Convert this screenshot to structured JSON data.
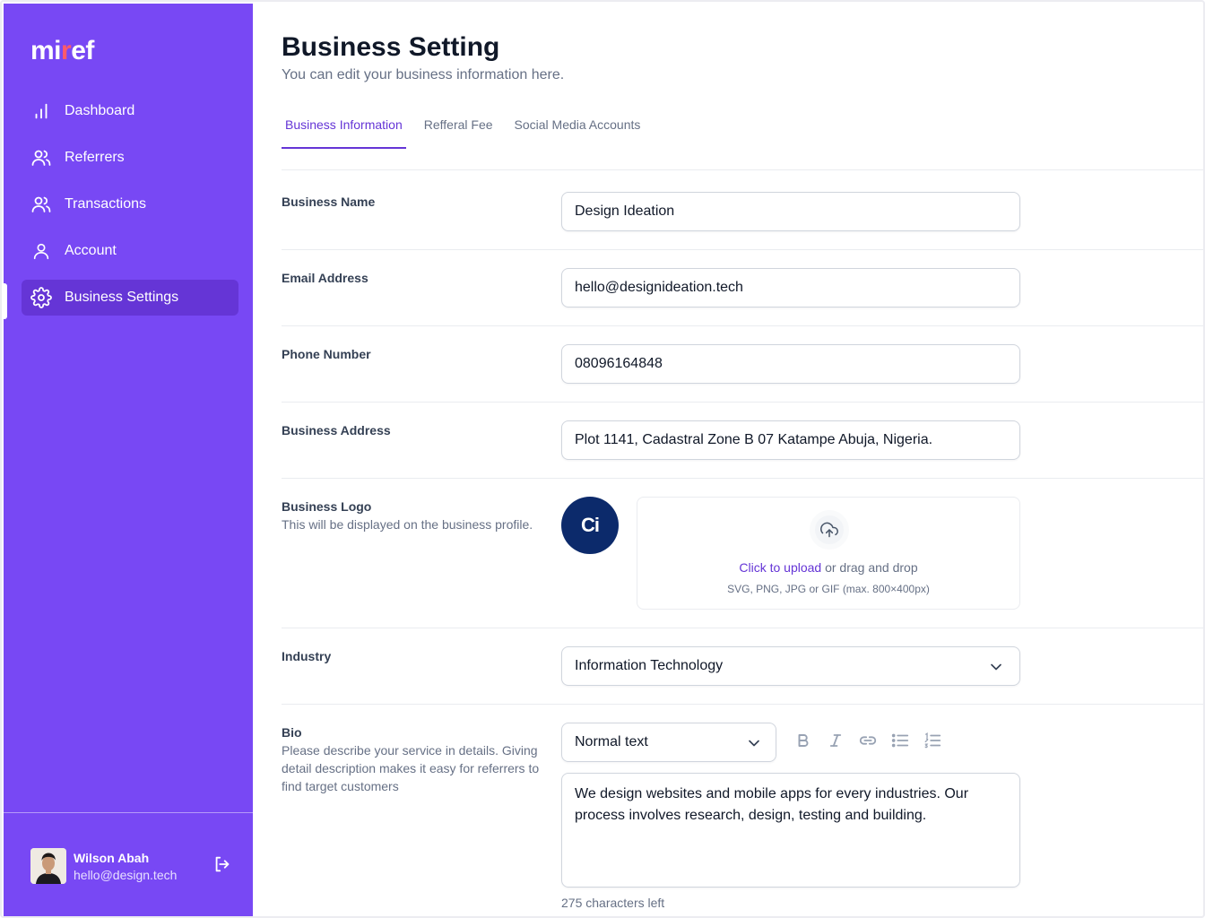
{
  "brand": {
    "logo_pre": "mi",
    "logo_r": "r",
    "logo_post": "ef",
    "accent": "#7848f4",
    "accent_dark": "#6535d6",
    "logo_r_color": "#ff5a6a"
  },
  "sidebar": {
    "items": [
      {
        "label": "Dashboard",
        "icon": "bar-chart-icon"
      },
      {
        "label": "Referrers",
        "icon": "users-icon"
      },
      {
        "label": "Transactions",
        "icon": "users-icon"
      },
      {
        "label": "Account",
        "icon": "user-icon"
      },
      {
        "label": "Business Settings",
        "icon": "gear-icon",
        "active": true
      }
    ],
    "user": {
      "name": "Wilson Abah",
      "email": "hello@design.tech"
    }
  },
  "header": {
    "title": "Business Setting",
    "subtitle": "You can edit your business information here."
  },
  "tabs": [
    {
      "label": "Business Information",
      "active": true
    },
    {
      "label": "Refferal Fee"
    },
    {
      "label": "Social Media Accounts"
    }
  ],
  "form": {
    "business_name": {
      "label": "Business Name",
      "value": "Design Ideation"
    },
    "email": {
      "label": "Email Address",
      "value": "hello@designideation.tech"
    },
    "phone": {
      "label": "Phone Number",
      "value": "08096164848"
    },
    "address": {
      "label": "Business Address",
      "value": "Plot 1141, Cadastral Zone B 07 Katampe Abuja, Nigeria."
    },
    "logo": {
      "label": "Business Logo",
      "hint": "This will be displayed on the business profile.",
      "badge": "Ci",
      "upload_link": "Click to upload",
      "upload_text": " or drag and drop",
      "upload_formats": "SVG, PNG, JPG or GIF (max. 800×400px)"
    },
    "industry": {
      "label": "Industry",
      "value": "Information Technology"
    },
    "bio": {
      "label": "Bio",
      "hint": "Please describe your service in details. Giving detail description makes it easy for referrers  to find target customers",
      "format": "Normal text",
      "value": "We design websites and mobile apps for every industries. Our process involves research, design, testing and building.",
      "chars_left": "275 characters left"
    }
  }
}
